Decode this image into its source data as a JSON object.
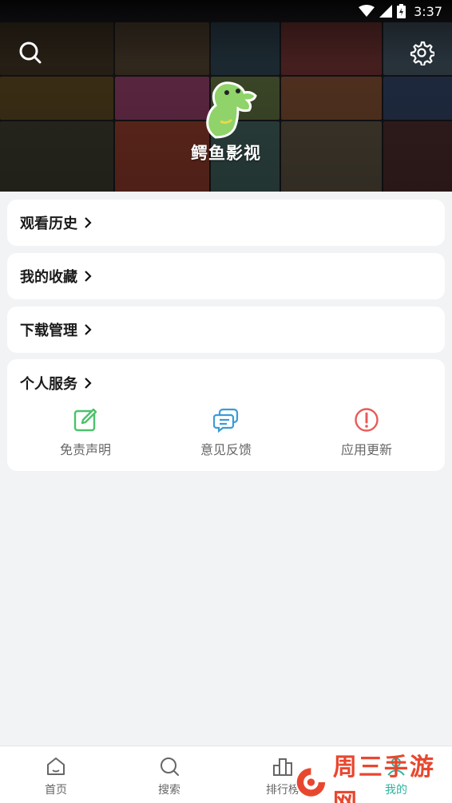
{
  "status_bar": {
    "time": "3:37"
  },
  "header": {
    "app_name": "鳄鱼影视",
    "search_icon": "search-icon",
    "settings_icon": "gear-icon",
    "poster_colors": [
      "#3a2f20",
      "#4a3c2c",
      "#2b3e4a",
      "#6a2f2f",
      "#3d4d5a",
      "#222b36",
      "#8a3a42",
      "#5a6a3c",
      "#7a4a30",
      "#2f2f3f",
      "#6b5a48",
      "#3f5f5a",
      "#8e4a2a",
      "#3a3a3a",
      "#504060"
    ]
  },
  "menu": [
    {
      "label": "观看历史"
    },
    {
      "label": "我的收藏"
    },
    {
      "label": "下载管理"
    }
  ],
  "services": {
    "title": "个人服务",
    "items": [
      {
        "label": "免责声明",
        "icon": "edit-icon",
        "color": "#4cc26b"
      },
      {
        "label": "意见反馈",
        "icon": "chat-icon",
        "color": "#3a9bd9"
      },
      {
        "label": "应用更新",
        "icon": "alert-icon",
        "color": "#e85a5a"
      }
    ]
  },
  "bottom_nav": [
    {
      "label": "首页",
      "icon": "home-icon"
    },
    {
      "label": "搜索",
      "icon": "search-icon"
    },
    {
      "label": "排行榜",
      "icon": "ranking-icon"
    },
    {
      "label": "我的",
      "icon": "profile-icon",
      "active": true
    }
  ],
  "watermark": {
    "text": "周三手游网"
  },
  "colors": {
    "accent": "#2bb5a0",
    "card_bg": "#ffffff",
    "page_bg": "#f2f3f5"
  }
}
